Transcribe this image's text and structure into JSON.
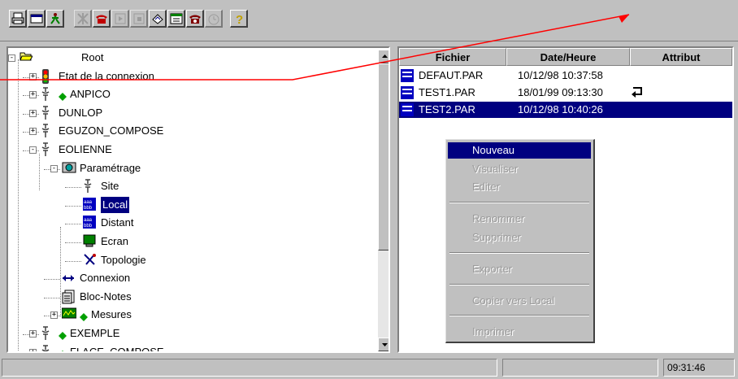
{
  "toolbar": {
    "buttons": [
      {
        "icon": "print-icon"
      },
      {
        "icon": "window-icon"
      },
      {
        "icon": "run-icon"
      },
      {
        "icon": "network-icon"
      },
      {
        "icon": "phone-icon"
      },
      {
        "icon": "play-icon"
      },
      {
        "icon": "stop-icon"
      },
      {
        "icon": "erase-icon"
      },
      {
        "icon": "calendar-icon"
      },
      {
        "icon": "alarm-phone-icon"
      },
      {
        "icon": "timer-icon"
      },
      {
        "icon": "help-icon"
      }
    ]
  },
  "tree": {
    "nodes": [
      {
        "label": "Root",
        "icon": "folder-open-icon"
      },
      {
        "label": "Etat de la connexion",
        "icon": "traffic-light-icon"
      },
      {
        "label": "ANPICO",
        "icon": "site-icon"
      },
      {
        "label": "DUNLOP",
        "icon": "site-icon"
      },
      {
        "label": "EGUZON_COMPOSE",
        "icon": "site-icon"
      },
      {
        "label": "EOLIENNE",
        "icon": "site-icon"
      },
      {
        "label": "Paramétrage",
        "icon": "settings-icon"
      },
      {
        "label": "Site",
        "icon": "site-icon"
      },
      {
        "label": "Local",
        "icon": "document-icon"
      },
      {
        "label": "Distant",
        "icon": "document-icon"
      },
      {
        "label": "Ecran",
        "icon": "screen-icon"
      },
      {
        "label": "Topologie",
        "icon": "topology-icon"
      },
      {
        "label": "Connexion",
        "icon": "connection-icon"
      },
      {
        "label": "Bloc-Notes",
        "icon": "notes-icon"
      },
      {
        "label": "Mesures",
        "icon": "chart-icon"
      },
      {
        "label": "EXEMPLE",
        "icon": "site-icon"
      },
      {
        "label": "FLACE_COMPOSE",
        "icon": "site-icon"
      }
    ],
    "selected_index": 8
  },
  "files": {
    "columns": [
      "Fichier",
      "Date/Heure",
      "Attribut"
    ],
    "rows": [
      {
        "name": "DEFAUT.PAR",
        "date": "10/12/98 10:37:58",
        "attr_icon": ""
      },
      {
        "name": "TEST1.PAR",
        "date": "18/01/99 09:13:30",
        "attr_icon": "return-arrow-icon"
      },
      {
        "name": "TEST2.PAR",
        "date": "10/12/98 10:40:26",
        "attr_icon": ""
      }
    ],
    "selected_index": 2
  },
  "context_menu": {
    "items": [
      {
        "label": "Nouveau",
        "enabled": true,
        "highlighted": true
      },
      {
        "label": "Visualiser",
        "enabled": false
      },
      {
        "label": "Editer",
        "enabled": false
      },
      {
        "label": "Renommer",
        "enabled": false
      },
      {
        "label": "Supprimer",
        "enabled": false
      },
      {
        "label": "Exporter",
        "enabled": false
      },
      {
        "label": "Copier vers Local",
        "enabled": false
      },
      {
        "label": "Imprimer",
        "enabled": false
      }
    ]
  },
  "status": {
    "time": "09:31:46"
  },
  "colors": {
    "selection": "#000080",
    "annotation_arrow": "#ff0000",
    "face": "#c0c0c0"
  }
}
